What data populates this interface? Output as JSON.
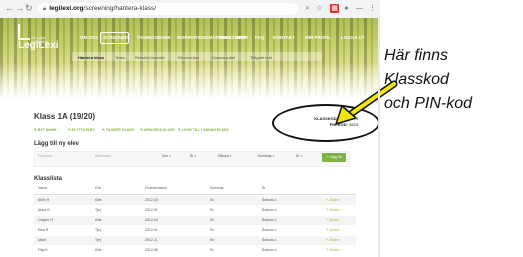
{
  "browser": {
    "url_host": "legilexi.org",
    "url_path": "/screening/hantera-klass/"
  },
  "app": {
    "logo_text": "LegiLexi",
    "logo_sub": "ett gratis nätverktyg",
    "nav": [
      "OM OSS",
      "SCREENING",
      "ÖVNINGSBANK",
      "INSPIRATIONSMATERIAL",
      "FORSKNING",
      "GDPR",
      "FAQ",
      "KONTAKT",
      "MIN PROFIL",
      "LOGGA UT"
    ],
    "subnav": [
      "Hantera klass",
      "Testa",
      "Resultat översikt",
      "Elevresultat",
      "Klassresultat",
      "Tidigare test"
    ]
  },
  "class": {
    "title": "Klass 1A (19/20)",
    "actions": [
      "BYT NAMN",
      "FLYTTA ELEV",
      "TA BORT KLASS",
      "ARKIVERA KLASS",
      "LÄGG TILL I ANNAN KLASS"
    ],
    "klasskod_label": "KLASSKOD:",
    "klasskod_value": "AJ41GF73",
    "pin_label": "PIN-KOD:",
    "pin_value": "9823"
  },
  "add_student": {
    "title": "Lägg till ny elev",
    "name_placeholder": "Förnamn",
    "surname_placeholder": "Efternamn",
    "dropdowns": [
      "Kön",
      "År",
      "Månad",
      "Kunskap",
      "År"
    ],
    "button": "Lägg till"
  },
  "list": {
    "title": "Klasslista",
    "columns": [
      "Namn",
      "Kön",
      "Födelsedatum",
      "Kunskap",
      "År",
      ""
    ],
    "rows": [
      [
        "Albin H",
        "Kille",
        "2012-03",
        "Sv",
        "Årskurs 1",
        "Ändra"
      ],
      [
        "Anna G",
        "Tjej",
        "2012-01",
        "Sv",
        "Årskurs 1",
        "Ändra"
      ],
      [
        "Casper H",
        "Kille",
        "2012-04",
        "Sv",
        "Årskurs 1",
        "Ändra"
      ],
      [
        "Elsa R",
        "Tjej",
        "2012-01",
        "Sv",
        "Årskurs 1",
        "Ändra"
      ],
      [
        "Marit",
        "Tjej",
        "2012-11",
        "Sv",
        "Årskurs 1",
        "Ändra"
      ],
      [
        "Filip K",
        "Kille",
        "2012-06",
        "Sv",
        "Årskurs 1",
        "Ändra"
      ]
    ]
  },
  "annotation": {
    "line1": "Här finns",
    "line2": "Klasskod",
    "line3": "och PIN-kod"
  }
}
